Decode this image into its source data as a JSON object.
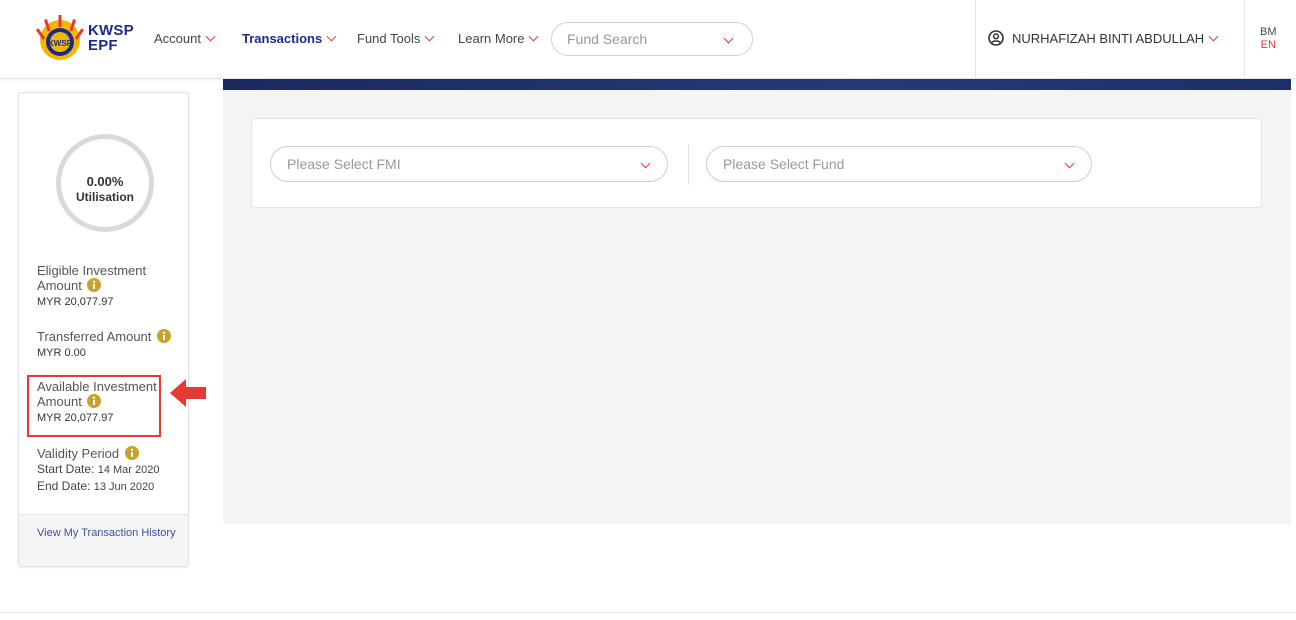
{
  "brand": {
    "line1": "KWSP",
    "line2": "EPF"
  },
  "nav": {
    "items": [
      {
        "label": "Account"
      },
      {
        "label": "Transactions"
      },
      {
        "label": "Fund Tools"
      },
      {
        "label": "Learn More"
      }
    ],
    "fund_search": "Fund Search",
    "user_name": "NURHAFIZAH BINTI ABDULLAH",
    "lang_bm": "BM",
    "lang_en": "EN"
  },
  "filters": {
    "fmi_placeholder": "Please Select FMI",
    "fund_placeholder": "Please Select Fund"
  },
  "sidebar": {
    "utilisation_pct": "0.00%",
    "utilisation_label": "Utilisation",
    "eligible_label": "Eligible Investment Amount",
    "eligible_value": "MYR 20,077.97",
    "transferred_label": "Transferred Amount",
    "transferred_value": "MYR 0.00",
    "available_label": "Available Investment Amount",
    "available_value": "MYR 20,077.97",
    "validity_label": "Validity Period",
    "start_label": "Start Date:",
    "start_value": "14 Mar 2020",
    "end_label": "End Date:",
    "end_value": "13 Jun 2020",
    "history_link": "View My Transaction History"
  },
  "colors": {
    "brand_blue": "#1c2b8a",
    "accent_red": "#e53935",
    "info_gold": "#c9a227"
  }
}
